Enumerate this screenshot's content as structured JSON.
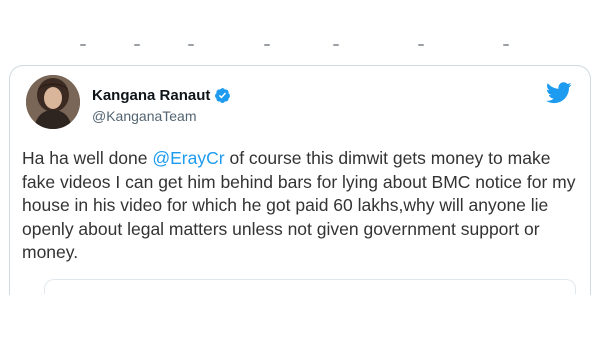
{
  "tweet": {
    "author": {
      "display_name": "Kangana Ranaut",
      "handle": "@KanganaTeam",
      "verified": true
    },
    "text_before_mention": "Ha ha well done ",
    "mention": "@ErayCr",
    "text_after_mention": " of course this dimwit gets money to make fake videos I can get him behind bars for lying about BMC notice for my house in his video for which he got paid 60 lakhs,why will anyone lie openly about legal matters unless not given government support or money."
  },
  "icons": {
    "avatar": "profile-photo",
    "verified": "verified-badge-icon",
    "brand": "twitter-bird-icon"
  },
  "colors": {
    "accent": "#1d9bf0",
    "text": "#333333",
    "secondary_text": "#536471",
    "border": "#cfd9de"
  }
}
